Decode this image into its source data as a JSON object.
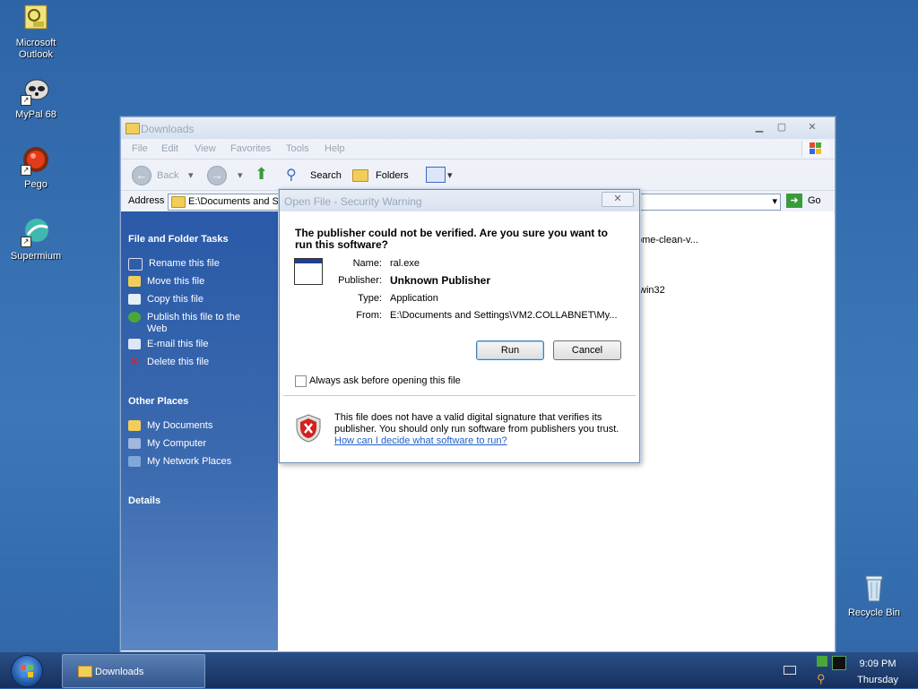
{
  "desktop": {
    "icons": [
      {
        "label": "Microsoft Outlook"
      },
      {
        "label": "MyPal 68"
      },
      {
        "label": "Pego"
      },
      {
        "label": "Supermium"
      },
      {
        "label": "Recycle Bin"
      }
    ]
  },
  "explorer": {
    "title": "Downloads",
    "menu": [
      "File",
      "Edit",
      "View",
      "Favorites",
      "Tools",
      "Help"
    ],
    "toolbar": {
      "back": "Back",
      "search": "Search",
      "folders": "Folders"
    },
    "address": {
      "label": "Address",
      "value": "E:\\Documents and S",
      "go": "Go"
    },
    "tasks_header": "File and Folder Tasks",
    "tasks": [
      "Rename this file",
      "Move this file",
      "Copy this file",
      "Publish this file to the Web",
      "E-mail this file",
      "Delete this file"
    ],
    "other_places_header": "Other Places",
    "other_places": [
      "My Documents",
      "My Computer",
      "My Network Places"
    ],
    "details_header": "Details",
    "files": [
      "ome-clean-v...",
      "win32"
    ]
  },
  "dialog": {
    "title": "Open File - Security Warning",
    "question": "The publisher could not be verified.  Are you sure you want to run this software?",
    "fields": [
      {
        "label": "Name:",
        "value": "ral.exe"
      },
      {
        "label": "Publisher:",
        "value": "Unknown Publisher"
      },
      {
        "label": "Type:",
        "value": "Application"
      },
      {
        "label": "From:",
        "value": "E:\\Documents and Settings\\VM2.COLLABNET\\My..."
      }
    ],
    "run_label": "Run",
    "cancel_label": "Cancel",
    "checkbox_label": "Always ask before opening this file",
    "checkbox_checked": false,
    "warning_text": "This file does not have a valid digital signature that verifies its publisher.  You should only run software from publishers you trust.",
    "help_link": "How can I decide what software to run?"
  },
  "taskbar": {
    "task_label": "Downloads",
    "time": "9:09 PM",
    "day": "Thursday"
  },
  "colors": {
    "accent": "#2a5aa8",
    "link": "#1f5fc6",
    "desktop": "#3a6ea5"
  }
}
